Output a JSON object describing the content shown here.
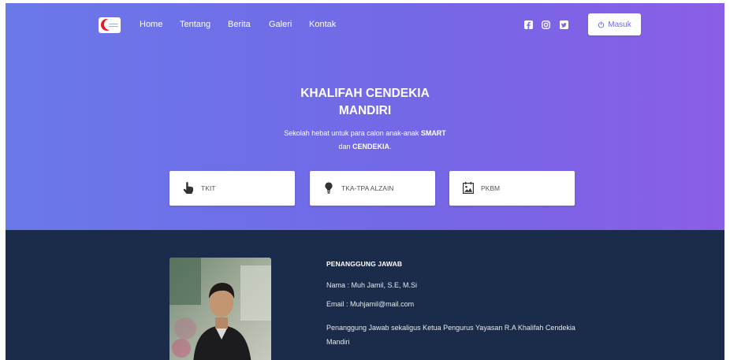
{
  "navbar": {
    "logo_alt": "logo",
    "links": [
      "Home",
      "Tentang",
      "Berita",
      "Galeri",
      "Kontak"
    ],
    "social_icons": [
      "facebook-icon",
      "instagram-icon",
      "twitter-icon"
    ],
    "login_label": "Masuk",
    "login_icon": "power-icon"
  },
  "hero": {
    "title_line1": "KHALIFAH CENDEKIA",
    "title_line2": "MANDIRI",
    "subtitle_part1": "Sekolah hebat untuk para calon anak-anak ",
    "subtitle_bold1": "SMART",
    "subtitle_part2": "dan ",
    "subtitle_bold2": "CENDEKIA",
    "subtitle_end": "."
  },
  "cards": [
    {
      "label": "TKIT",
      "icon": "hand-pointer-icon"
    },
    {
      "label": "TKA-TPA ALZAIN",
      "icon": "lightbulb-icon"
    },
    {
      "label": "PKBM",
      "icon": "picture-icon"
    }
  ],
  "info": {
    "heading": "PENANGGUNG JAWAB",
    "name": "Nama : Muh Jamil, S.E, M.Si",
    "email": "Email : Muhjamil@mail.com",
    "description": "Penanggung Jawab sekaligus Ketua Pengurus Yayasan R.A Khalifah Cendekia Mandiri"
  },
  "colors": {
    "hero_gradient_start": "#6a79e9",
    "hero_gradient_end": "#8a5ee6",
    "footer_bg": "#1b2b4a",
    "accent": "#6f6be7"
  }
}
